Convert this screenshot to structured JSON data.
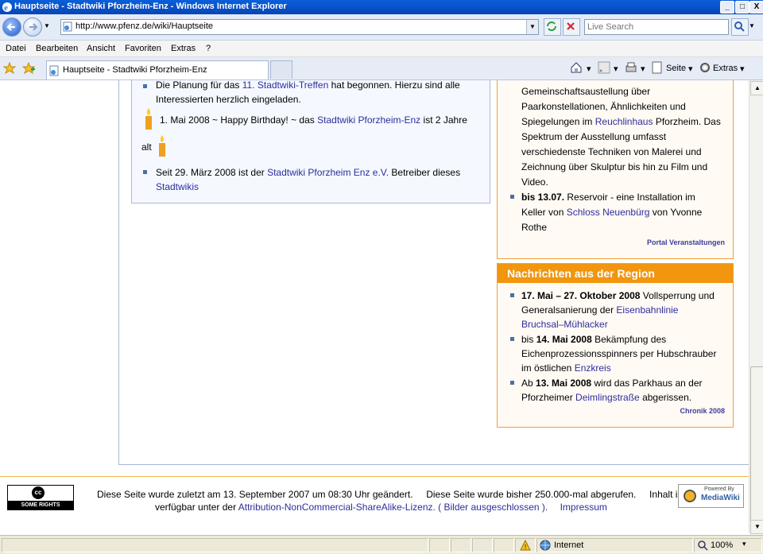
{
  "window": {
    "title": "Hauptseite - Stadtwiki Pforzheim-Enz - Windows Internet Explorer",
    "min": "_",
    "max": "□",
    "close": "X"
  },
  "addressbar": {
    "url": "http://www.pfenz.de/wiki/Hauptseite",
    "search_placeholder": "Live Search"
  },
  "menu": [
    "Datei",
    "Bearbeiten",
    "Ansicht",
    "Favoriten",
    "Extras",
    "?"
  ],
  "tab": {
    "label": "Hauptseite - Stadtwiki Pforzheim-Enz"
  },
  "commandbar": {
    "page": "Seite",
    "tools": "Extras"
  },
  "main": {
    "item1_line1_pre": "Die Planung für das",
    "item1_line1_link": "11. Stadtwiki-Treffen",
    "item1_line1_post": "hat begonnen. Hierzu sind alle",
    "item1_line2": "Interessierten herzlich eingeladen.",
    "item2_pre": "1. Mai 2008 ~ Happy Birthday! ~ das",
    "item2_link": "Stadtwiki Pforzheim-Enz",
    "item2_post": "ist 2 Jahre",
    "item2_line2": "alt",
    "item3_pre": "Seit 29. März 2008 ist der",
    "item3_link": "Stadtwiki Pforzheim Enz e.V.",
    "item3_post": "Betreiber dieses",
    "item3_link2": "Stadtwikis"
  },
  "portal": {
    "l1": "Gemeinschaftsaustellung über",
    "l2": "Paarkonstellationen, Ähnlichkeiten und",
    "l3_pre": "Spiegelungen im",
    "l3_link": "Reuchlinhaus",
    "l3_post": "Pforzheim. Das",
    "l4": "Spektrum der Ausstellung umfasst",
    "l5": "verschiedenste Techniken von Malerei und",
    "l6": "Zeichnung über Skulptur bis hin zu Film und",
    "l7": "Video.",
    "b2_date": "bis 13.07.",
    "b2_text": "Reservoir - eine Installation im",
    "b2_l2_pre": "Keller von",
    "b2_l2_link": "Schloss Neuenbürg",
    "b2_l2_post": "von Yvonne",
    "b2_l3": "Rothe",
    "footer_link": "Portal Veranstaltungen"
  },
  "news": {
    "heading": "Nachrichten aus der Region",
    "n1_date": "17. Mai – 27. Oktober 2008",
    "n1_text": "Vollsperrung und",
    "n1_l2_pre": "Generalsanierung der",
    "n1_l2_link": "Eisenbahnlinie",
    "n1_l3_link": "Bruchsal–Mühlacker",
    "n2_pre": "bis",
    "n2_date": "14. Mai 2008",
    "n2_text": "Bekämpfung des",
    "n2_l2": "Eichenprozessionsspinners per Hubschrauber",
    "n2_l3_pre": "im östlichen",
    "n2_l3_link": "Enzkreis",
    "n3_pre": "Ab",
    "n3_date": "13. Mai 2008",
    "n3_text": "wird das Parkhaus an der",
    "n3_l2_pre": "Pforzheimer",
    "n3_l2_link": "Deimlingstraße",
    "n3_l2_post": "abgerissen.",
    "footer_link": "Chronik 2008"
  },
  "footer": {
    "cc_badge": "SOME RIGHTS RESERVED",
    "cc_symbol": "cc",
    "line1": "Diese Seite wurde zuletzt am 13. September 2007 um 08:30 Uhr geändert.     Diese Seite wurde bisher 250.000-mal abgerufen.     Inhalt ist",
    "line2_pre": "verfügbar unter der",
    "license_link": "Attribution-NonCommercial-ShareAlike-Lizenz. ( Bilder ausgeschlossen ).",
    "impressum": "Impressum",
    "mw_powered": "Powered By",
    "mw_name": "MediaWiki"
  },
  "statusbar": {
    "zone": "Internet",
    "zoom": "100%"
  }
}
